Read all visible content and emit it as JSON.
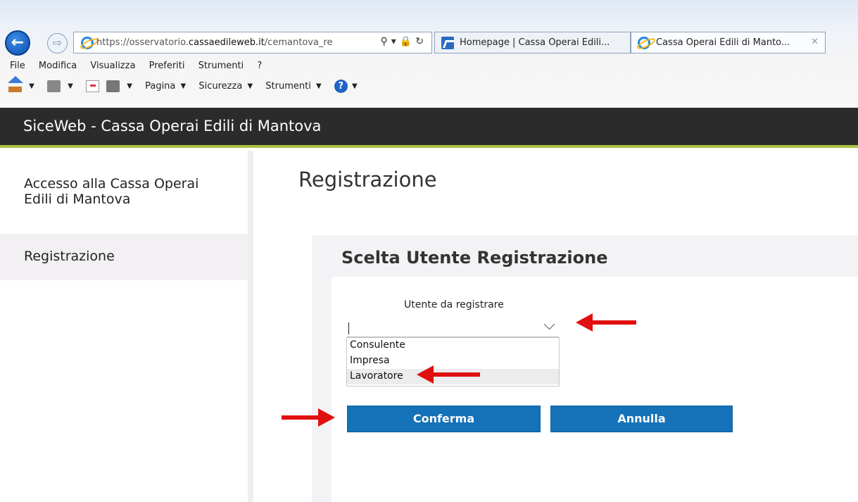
{
  "browser": {
    "url_prefix": "https://osservatorio.",
    "url_domain": "cassaedileweb.it",
    "url_suffix": "/cemantova_re",
    "tabs": [
      {
        "label": "Homepage | Cassa Operai Edili..."
      },
      {
        "label": "Cassa Operai Edili di Manto..."
      }
    ],
    "tab_close": "✕",
    "addr_tools": "⚲▾🔒↻",
    "menu": [
      "File",
      "Modifica",
      "Visualizza",
      "Preferiti",
      "Strumenti",
      "?"
    ],
    "toolbar": {
      "page": "Pagina",
      "security": "Sicurezza",
      "tools": "Strumenti"
    },
    "caret": "▼",
    "help": "?"
  },
  "app": {
    "title": "SiceWeb - Cassa Operai Edili di Mantova"
  },
  "sidebar": {
    "items": [
      {
        "label": "Accesso alla Cassa Operai Edili di Mantova"
      },
      {
        "label": "Registrazione",
        "selected": true
      }
    ]
  },
  "main": {
    "title": "Registrazione",
    "panel_title": "Scelta Utente Registrazione",
    "field_label": "Utente da registrare",
    "selected_value": "",
    "options": [
      "Consulente",
      "Impresa",
      "Lavoratore"
    ],
    "highlighted_option": "Lavoratore",
    "confirm_label": "Conferma",
    "cancel_label": "Annulla"
  },
  "colors": {
    "header_bg": "#2b2b2b",
    "header_accent": "#a9c23f",
    "button": "#1572b8",
    "annotation_arrow": "#e01010"
  }
}
